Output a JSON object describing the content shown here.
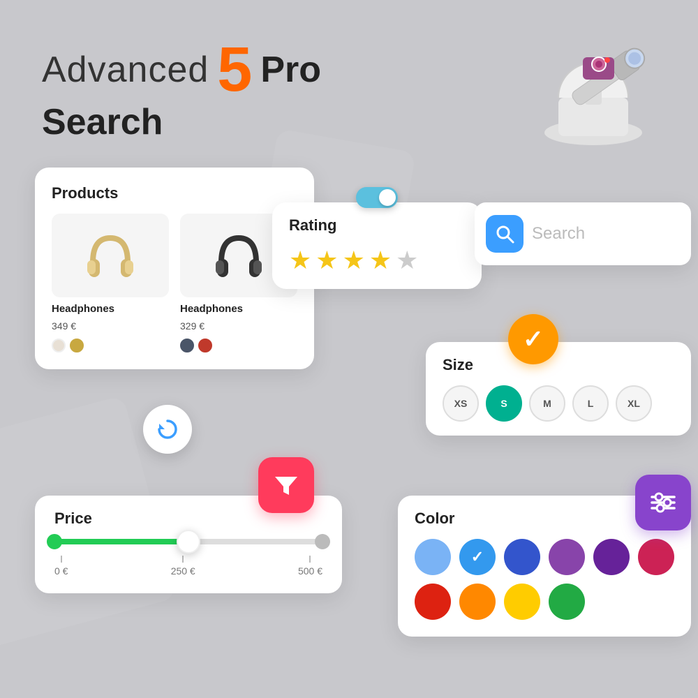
{
  "title": {
    "line1_part1": "Advanced",
    "number": "5",
    "pro": "Pro",
    "line2": "Search"
  },
  "products_card": {
    "title": "Products",
    "items": [
      {
        "name": "Headphones",
        "price": "349 €",
        "colors": [
          "#e8e0d5",
          "#c8a840"
        ]
      },
      {
        "name": "Headphones",
        "price": "329 €",
        "colors": [
          "#4a5568",
          "#c0392b"
        ]
      }
    ]
  },
  "rating_card": {
    "title": "Rating",
    "stars_filled": 4,
    "stars_total": 5
  },
  "search_placeholder": "Search",
  "size_card": {
    "title": "Size",
    "options": [
      "XS",
      "S",
      "M",
      "L",
      "XL"
    ],
    "active": "S"
  },
  "price_card": {
    "title": "Price",
    "min": "0 €",
    "mid": "250 €",
    "max": "500 €"
  },
  "color_card": {
    "title": "Color",
    "colors": [
      {
        "hex": "#7ab3f5",
        "selected": false
      },
      {
        "hex": "#3399ee",
        "selected": true
      },
      {
        "hex": "#3355cc",
        "selected": false
      },
      {
        "hex": "#8844aa",
        "selected": false
      },
      {
        "hex": "#662299",
        "selected": false
      },
      {
        "hex": "#cc2255",
        "selected": false
      },
      {
        "hex": "#dd2211",
        "selected": false
      },
      {
        "hex": "#ff8800",
        "selected": false
      },
      {
        "hex": "#ffcc00",
        "selected": false
      },
      {
        "hex": "#22aa44",
        "selected": false
      }
    ]
  },
  "buttons": {
    "filter": "filter",
    "refresh": "refresh",
    "settings": "settings"
  }
}
